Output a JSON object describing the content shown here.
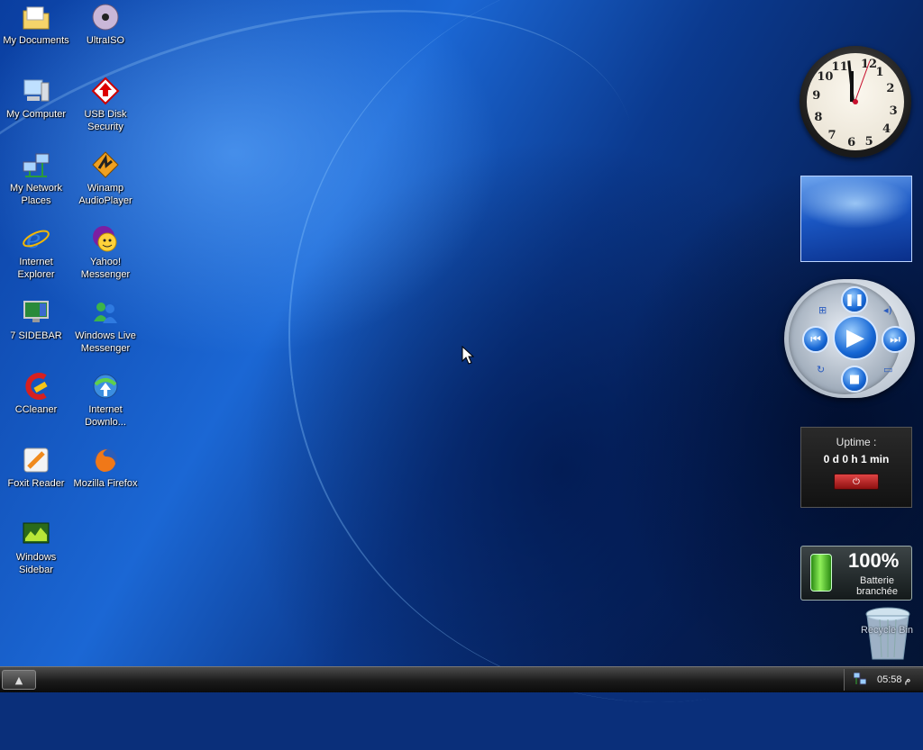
{
  "desktop_icons": [
    {
      "label": "My Documents",
      "icon": "folder-icon"
    },
    {
      "label": "UltraISO",
      "icon": "disc-icon"
    },
    {
      "label": "My Computer",
      "icon": "computer-icon"
    },
    {
      "label": "USB Disk Security",
      "icon": "usb-shield-icon"
    },
    {
      "label": "My Network Places",
      "icon": "network-icon"
    },
    {
      "label": "Winamp AudioPlayer",
      "icon": "winamp-icon"
    },
    {
      "label": "Internet Explorer",
      "icon": "ie-icon"
    },
    {
      "label": "Yahoo! Messenger",
      "icon": "yahoo-icon"
    },
    {
      "label": "7 SIDEBAR",
      "icon": "monitor-icon"
    },
    {
      "label": "Windows Live Messenger",
      "icon": "messenger-icon"
    },
    {
      "label": "CCleaner",
      "icon": "ccleaner-icon"
    },
    {
      "label": "Internet Downlo...",
      "icon": "idm-icon"
    },
    {
      "label": "Foxit Reader",
      "icon": "pdf-icon"
    },
    {
      "label": "Mozilla Firefox",
      "icon": "firefox-icon"
    },
    {
      "label": "Windows Sidebar",
      "icon": "sidebar-icon"
    }
  ],
  "gadgets": {
    "clock": {
      "numbers": [
        "12",
        "1",
        "2",
        "3",
        "4",
        "5",
        "6",
        "7",
        "8",
        "9",
        "10",
        "11"
      ],
      "time": "11:58"
    },
    "uptime": {
      "label": "Uptime :",
      "value": "0 d 0 h 1 min"
    },
    "battery": {
      "percent": "100%",
      "status": "Batterie branchée"
    },
    "recycle_bin": {
      "label": "Recycle Bin"
    }
  },
  "taskbar": {
    "start_symbol": "▲",
    "clock": "05:58 م"
  }
}
